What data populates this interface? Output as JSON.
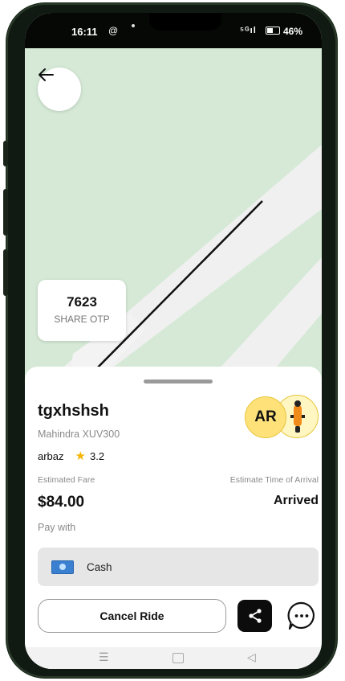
{
  "status_bar": {
    "time": "16:11",
    "notif_icon": "@",
    "signal": "⁹⁵ᵃil",
    "battery": "46%"
  },
  "map": {
    "back_icon": "arrow-left-icon",
    "otp": {
      "code": "7623",
      "label": "SHARE OTP"
    }
  },
  "ride": {
    "rider_name": "tgxhshsh",
    "vehicle": "Mahindra XUV300",
    "driver_name": "arbaz",
    "rating": "3.2",
    "avatar_initials": "AR",
    "est_fare_label": "Estimated Fare",
    "fare": "$84.00",
    "eta_label": "Estimate Time of Arrival",
    "eta_value": "Arrived",
    "pay_with_label": "Pay with",
    "payment_method": "Cash"
  },
  "actions": {
    "cancel_label": "Cancel Ride",
    "share_icon": "share-icon",
    "chat_icon": "chat-icon"
  },
  "colors": {
    "map_green": "#d5e9d6",
    "road": "#f0f0f0",
    "star": "#f4b400",
    "avatar_yellow": "#ffe17a"
  }
}
